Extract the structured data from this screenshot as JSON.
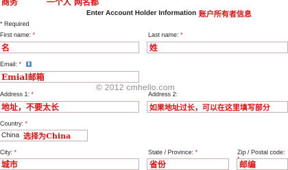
{
  "top_notes": {
    "left": "商务",
    "middle": "一个人    网名都"
  },
  "section": {
    "title": "Enter Account Holder Information",
    "title_note": "账户所有者信息"
  },
  "required_note": "* Required",
  "fields": {
    "first_name": {
      "label": "First name:",
      "required": "*",
      "value": "名"
    },
    "last_name": {
      "label": "Last name:",
      "required": "*",
      "value": "姓"
    },
    "email": {
      "label": "Email:",
      "required": "*",
      "value": "Emial邮箱"
    },
    "address1": {
      "label": "Address 1:",
      "required": "*",
      "value": "地址，不要太长"
    },
    "address2": {
      "label": "Address 2:",
      "required": "",
      "value": "如果地址过长，可以在这里填写部分"
    },
    "country": {
      "label": "Country:",
      "required": "*",
      "value": "China",
      "note": "选择为China"
    },
    "city": {
      "label": "City:",
      "required": "*",
      "value": "城市"
    },
    "state": {
      "label": "State / Province:",
      "required": "*",
      "value": "省份"
    },
    "zip": {
      "label": "Zip / Postal code:",
      "required": "*",
      "value": "邮编"
    }
  },
  "icons": {
    "email_help": "info-icon"
  },
  "watermark": "© 2012 cmhello.com"
}
